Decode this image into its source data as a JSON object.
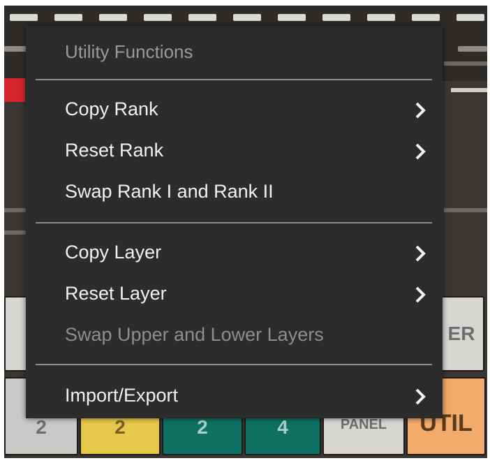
{
  "menu": {
    "header": "Utility Functions",
    "groups": [
      {
        "items": [
          {
            "label": "Copy Rank",
            "submenu": true,
            "enabled": true
          },
          {
            "label": "Reset Rank",
            "submenu": true,
            "enabled": true
          },
          {
            "label": "Swap Rank I and Rank II",
            "submenu": false,
            "enabled": true
          }
        ]
      },
      {
        "items": [
          {
            "label": "Copy Layer",
            "submenu": true,
            "enabled": true
          },
          {
            "label": "Reset Layer",
            "submenu": true,
            "enabled": true
          },
          {
            "label": "Swap Upper and Lower Layers",
            "submenu": false,
            "enabled": false
          }
        ]
      },
      {
        "items": [
          {
            "label": "Import/Export",
            "submenu": true,
            "enabled": true
          }
        ]
      }
    ]
  },
  "background": {
    "bottom_buttons": [
      "2",
      "2",
      "2",
      "4",
      "PANEL",
      "UTIL"
    ],
    "side_button_right_text": "ER"
  },
  "colors": {
    "menu_bg": "#2c2c2c",
    "item_text": "#f2f2f2",
    "disabled_text": "#8e8e8e",
    "separator": "#8c8c8c"
  },
  "icons": {
    "submenu_indicator": "chevron-right-icon"
  }
}
